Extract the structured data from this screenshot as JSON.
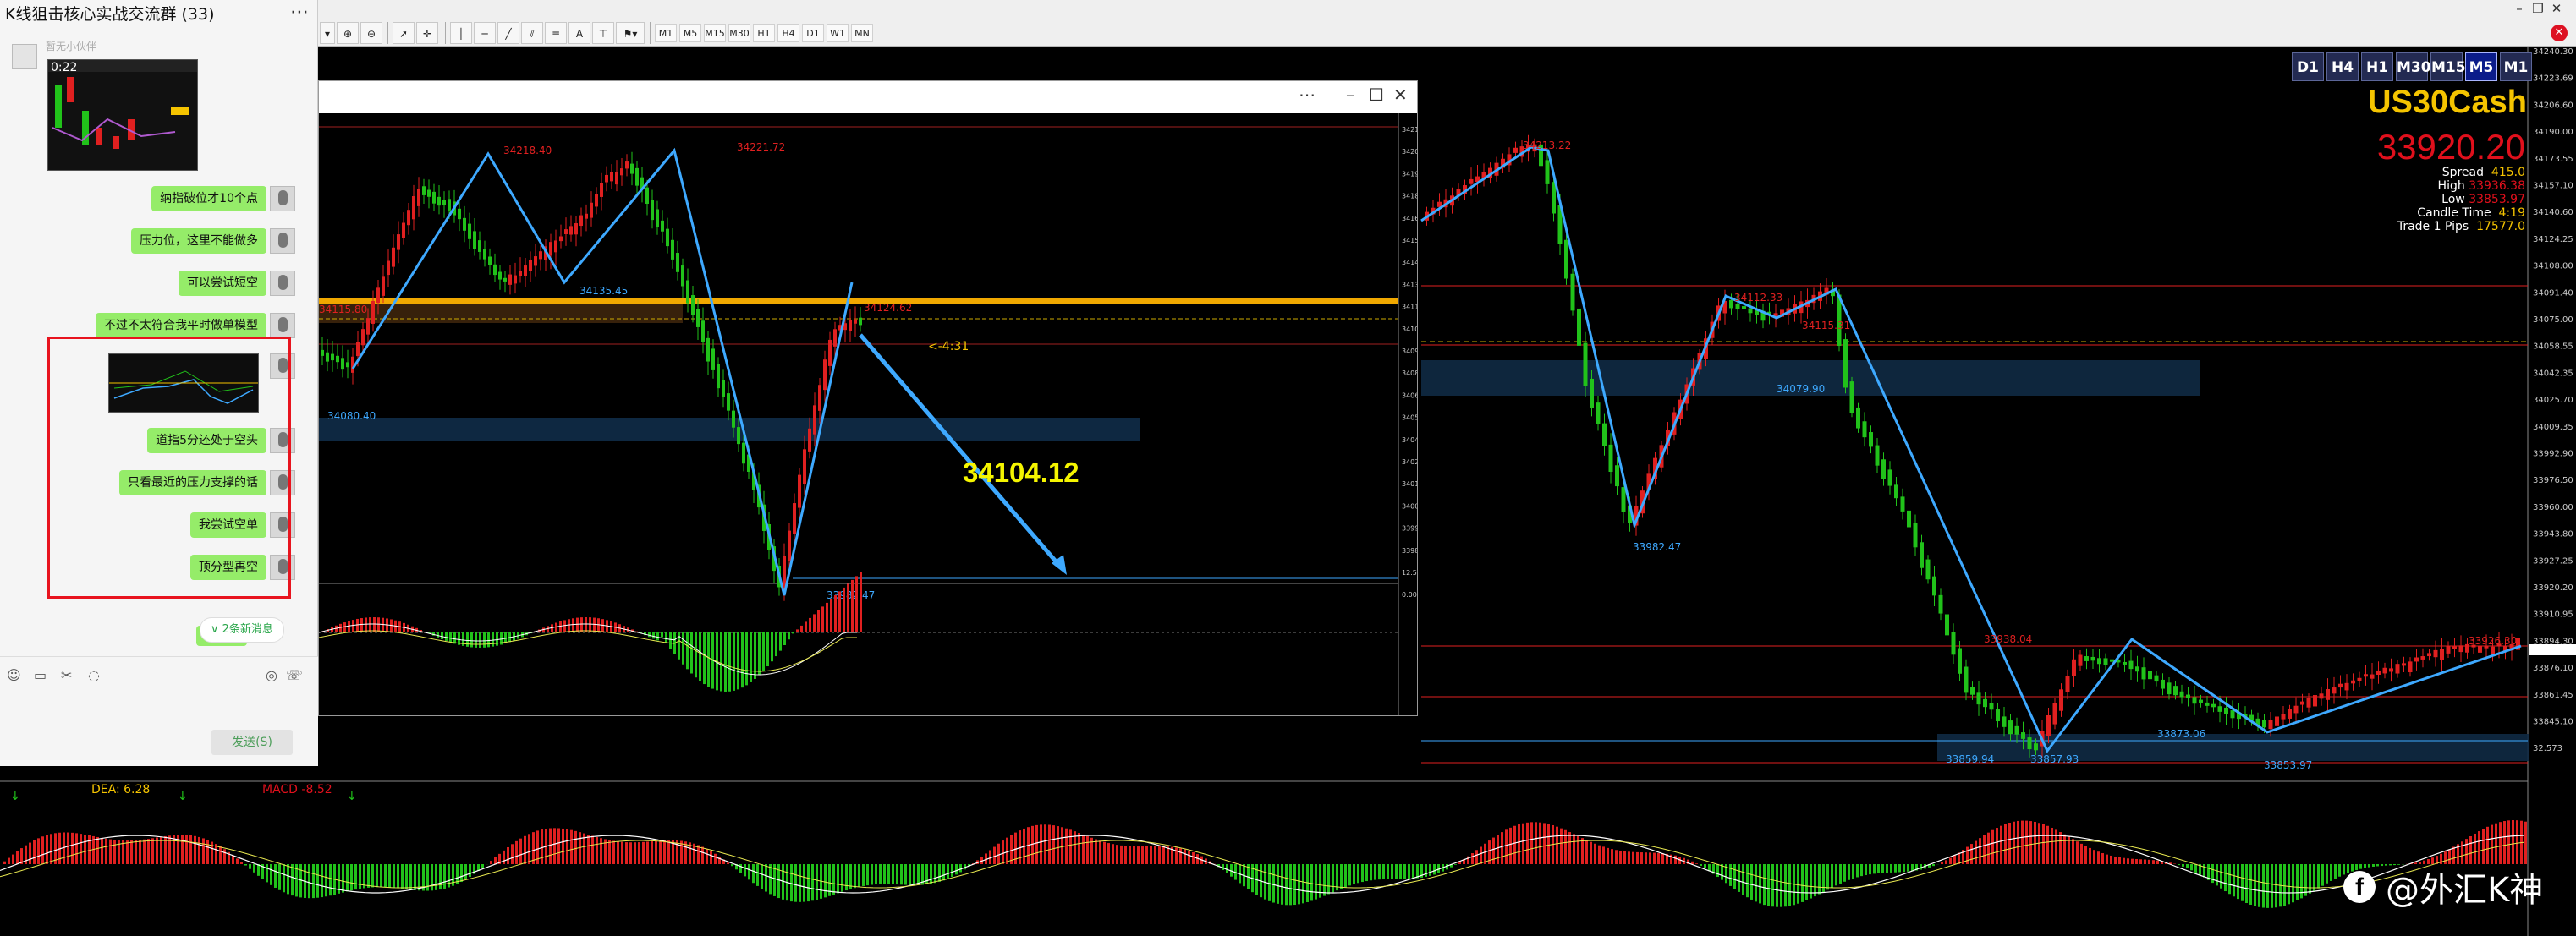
{
  "toolbar": {
    "timeframes": [
      "M1",
      "M5",
      "M15",
      "M30",
      "H1",
      "H4",
      "D1",
      "W1",
      "MN"
    ]
  },
  "chart": {
    "symbol": "US30Cash",
    "bid": "33920.20",
    "timeframe_buttons": [
      "D1",
      "H4",
      "H1",
      "M30",
      "M15",
      "M5",
      "M1"
    ],
    "active_timeframe": "M5",
    "info": {
      "spread_label": "Spread",
      "spread": "415.0",
      "high_label": "High",
      "high": "33936.38",
      "low_label": "Low",
      "low": "33853.97",
      "candle_label": "Candle Time",
      "candle_time": "4:19",
      "pips_label": "Trade 1 Pips",
      "pips": "17577.0"
    },
    "price_axis": [
      "34240.30",
      "34223.69",
      "34206.60",
      "34190.00",
      "34173.55",
      "34157.10",
      "34140.60",
      "34124.25",
      "34108.00",
      "34091.40",
      "34075.00",
      "34058.55",
      "34042.35",
      "34025.70",
      "34009.35",
      "33992.90",
      "33976.50",
      "33960.00",
      "33943.80",
      "33927.25",
      "33920.20",
      "33910.95",
      "33894.30",
      "33876.10",
      "33861.45",
      "33845.10",
      "32.573"
    ],
    "swing_labels": [
      "34213.22",
      "34112.33",
      "34115.31",
      "33982.47",
      "34079.90",
      "33938.04",
      "33859.94",
      "33857.93",
      "33873.06",
      "33853.97",
      "33926.30"
    ],
    "macd": {
      "dea_label": "DEA:",
      "dea": "6.28",
      "macd_label": "MACD",
      "macd": "-8.52"
    },
    "colors": {
      "up": "#e02020",
      "down": "#21c21a",
      "zigzag": "#3ea9ff",
      "accent": "#f5c400"
    }
  },
  "subchart": {
    "current_price": "34104.12",
    "swing_labels": [
      "34218.40",
      "34221.72",
      "34135.45",
      "34080.40",
      "34115.80",
      "34124.62",
      "33982.47"
    ],
    "countdown": "<-4:31",
    "price_axis": [
      "34216",
      "34208",
      "34191",
      "34181",
      "34167",
      "34158",
      "34142",
      "34133",
      "34118",
      "34104",
      "34091",
      "34081",
      "34068",
      "34055",
      "34042",
      "34029",
      "34016",
      "34003",
      "33990",
      "33980",
      "12.57",
      "0.00"
    ]
  },
  "chat": {
    "title": "K线狙击核心实战交流群 (33)",
    "hint": "暂无小伙伴",
    "time": "0:22",
    "messages": [
      "纳指破位才10个点",
      "压力位，这里不能做多",
      "可以尝试短空",
      "不过不太符合我平时做单模型",
      "道指5分还处于空头",
      "只看最近的压力支撑的话",
      "我尝试空单",
      "顶分型再空"
    ],
    "new_messages": "2条新消息",
    "send_label": "发送(S)"
  },
  "watermark": {
    "text": "@外汇K神"
  }
}
